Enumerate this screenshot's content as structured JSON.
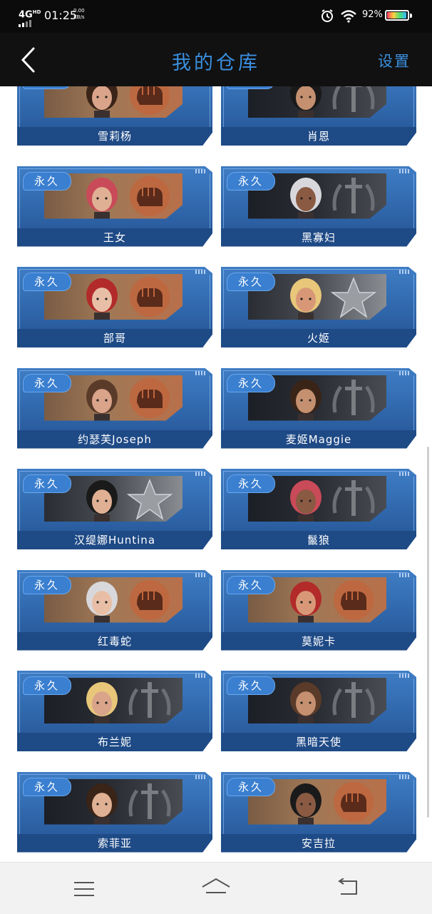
{
  "status_bar": {
    "network": "4G",
    "network_sup": "HD",
    "time": "01:25",
    "speed_value": "0.00",
    "speed_unit": "KB/s",
    "battery": "92%"
  },
  "header": {
    "title": "我的仓库",
    "settings": "设置"
  },
  "badge_label": "永久",
  "characters": [
    {
      "name": "雪莉杨",
      "emblem": "fist-emblem",
      "style": "fist"
    },
    {
      "name": "肖恩",
      "emblem": "sword-laurel-emblem",
      "style": "dark"
    },
    {
      "name": "王女",
      "emblem": "fist-emblem",
      "style": "fist"
    },
    {
      "name": "黑寡妇",
      "emblem": "sword-laurel-emblem",
      "style": "dark"
    },
    {
      "name": "部哥",
      "emblem": "fist-emblem",
      "style": "fist"
    },
    {
      "name": "火姬",
      "emblem": "star-emblem",
      "style": "silver"
    },
    {
      "name": "约瑟芙Joseph",
      "emblem": "fist-emblem",
      "style": "fist"
    },
    {
      "name": "麦姬Maggie",
      "emblem": "sword-laurel-emblem",
      "style": "dark"
    },
    {
      "name": "汉缇娜Huntina",
      "emblem": "star-emblem",
      "style": "silver"
    },
    {
      "name": "鬣狼",
      "emblem": "sword-laurel-emblem",
      "style": "dark"
    },
    {
      "name": "红毒蛇",
      "emblem": "fist-emblem",
      "style": "fist"
    },
    {
      "name": "莫妮卡",
      "emblem": "fist-emblem",
      "style": "fist"
    },
    {
      "name": "布兰妮",
      "emblem": "sword-laurel-emblem",
      "style": "dark"
    },
    {
      "name": "黑暗天使",
      "emblem": "sword-laurel-emblem",
      "style": "dark"
    },
    {
      "name": "索菲亚",
      "emblem": "sword-laurel-emblem",
      "style": "dark"
    },
    {
      "name": "安吉拉",
      "emblem": "fist-emblem",
      "style": "fist"
    }
  ],
  "colors": {
    "accent": "#3a8fe0",
    "card": "#2e64a8",
    "badge": "#3a7fd0"
  }
}
